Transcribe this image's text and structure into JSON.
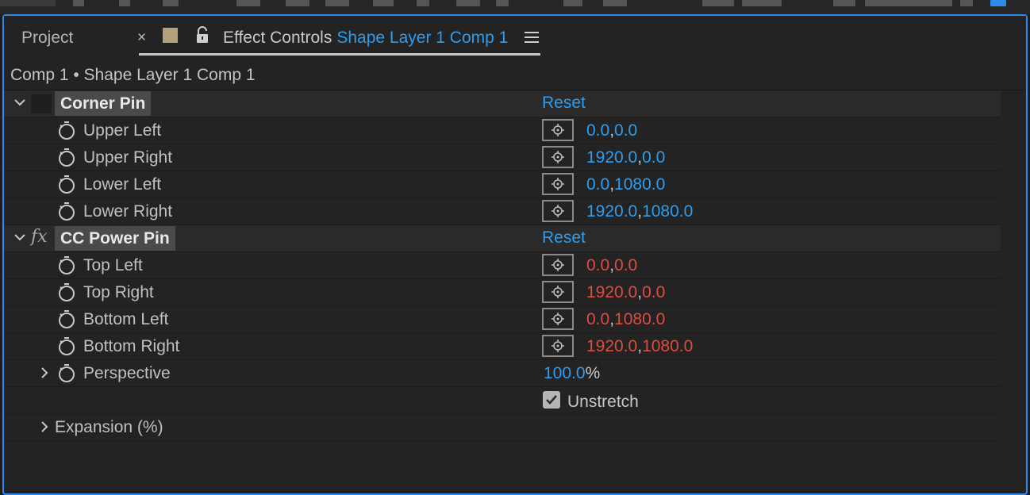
{
  "tabs": {
    "project_label": "Project",
    "close_glyph": "×",
    "effect_controls_label": "Effect Controls",
    "effect_controls_comp": "Shape Layer 1 Comp 1"
  },
  "breadcrumb": "Comp 1 • Shape Layer 1 Comp 1",
  "effects": [
    {
      "name": "Corner Pin",
      "reset_label": "Reset",
      "properties": [
        {
          "label": "Upper Left",
          "x": "0.0",
          "y": "0.0",
          "color": "blue"
        },
        {
          "label": "Upper Right",
          "x": "1920.0",
          "y": "0.0",
          "color": "blue"
        },
        {
          "label": "Lower Left",
          "x": "0.0",
          "y": "1080.0",
          "color": "blue"
        },
        {
          "label": "Lower Right",
          "x": "1920.0",
          "y": "1080.0",
          "color": "blue"
        }
      ]
    },
    {
      "name": "CC Power Pin",
      "fx_icon": "fx",
      "reset_label": "Reset",
      "properties": [
        {
          "label": "Top Left",
          "x": "0.0",
          "y": "0.0",
          "color": "red"
        },
        {
          "label": "Top Right",
          "x": "1920.0",
          "y": "0.0",
          "color": "red"
        },
        {
          "label": "Bottom Left",
          "x": "0.0",
          "y": "1080.0",
          "color": "red"
        },
        {
          "label": "Bottom Right",
          "x": "1920.0",
          "y": "1080.0",
          "color": "red"
        }
      ],
      "perspective": {
        "label": "Perspective",
        "value": "100.0",
        "unit": "%"
      },
      "unstretch": {
        "label": "Unstretch",
        "checked": true
      },
      "expansion_label": "Expansion (%)"
    }
  ],
  "colors": {
    "accent_blue": "#2d9df0",
    "value_red": "#e04a3f",
    "panel_border": "#2d8ceb"
  }
}
